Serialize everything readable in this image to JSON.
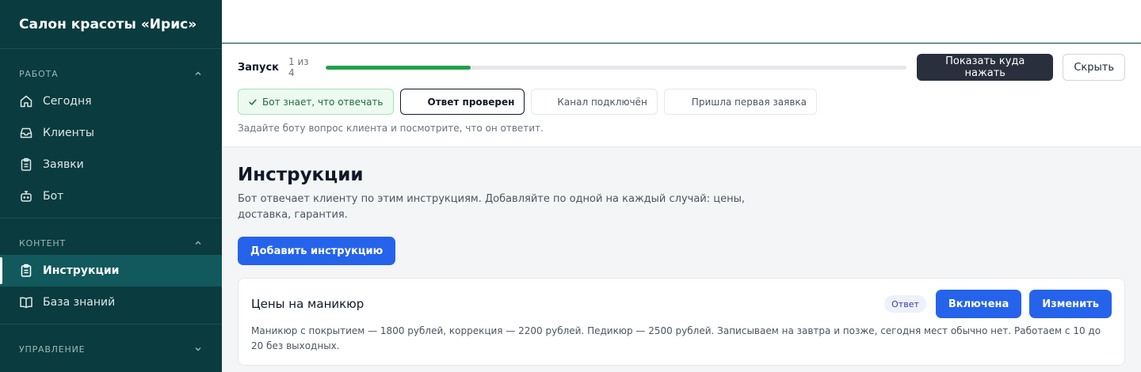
{
  "sidebar": {
    "brand": "Салон красоты «Ирис»",
    "sections": [
      {
        "title": "РАБОТА",
        "items": [
          {
            "label": "Сегодня",
            "icon": "home-icon"
          },
          {
            "label": "Клиенты",
            "icon": "inbox-icon"
          },
          {
            "label": "Заявки",
            "icon": "clipboard-icon"
          },
          {
            "label": "Бот",
            "icon": "bot-icon"
          }
        ]
      },
      {
        "title": "КОНТЕНТ",
        "items": [
          {
            "label": "Инструкции",
            "icon": "clipboard-icon",
            "active": true
          },
          {
            "label": "База знаний",
            "icon": "book-icon"
          }
        ]
      },
      {
        "title": "УПРАВЛЕНИЕ",
        "items": []
      }
    ]
  },
  "onboarding": {
    "title": "Запуск",
    "step": "1 из 4",
    "progress_fraction": 0.25,
    "show_button": "Показать куда нажать",
    "hide_button": "Скрыть",
    "steps": [
      {
        "label": "Бот знает, что отвечать",
        "state": "done"
      },
      {
        "label": "Ответ проверен",
        "state": "current"
      },
      {
        "label": "Канал подключён",
        "state": "pending"
      },
      {
        "label": "Пришла первая заявка",
        "state": "pending"
      }
    ],
    "hint": "Задайте боту вопрос клиента и посмотрите, что он ответит."
  },
  "main": {
    "title": "Инструкции",
    "description": "Бот отвечает клиенту по этим инструкциям. Добавляйте по одной на каждый случай: цены, доставка, гарантия.",
    "add_button": "Добавить инструкцию",
    "instructions": [
      {
        "title": "Цены на маникюр",
        "badge": "Ответ",
        "toggle_label": "Включена",
        "edit_label": "Изменить",
        "body": "Маникюр с покрытием — 1800 рублей, коррекция — 2200 рублей. Педикюр — 2500 рублей. Записываем на завтра и позже, сегодня мест обычно нет. Работаем с 10 до 20 без выходных."
      }
    ]
  },
  "colors": {
    "sidebar_bg": "#0a3b3e",
    "sidebar_active": "#11595c",
    "primary": "#2563eb",
    "progress": "#22a04b",
    "dark_button": "#2a2f3d"
  }
}
